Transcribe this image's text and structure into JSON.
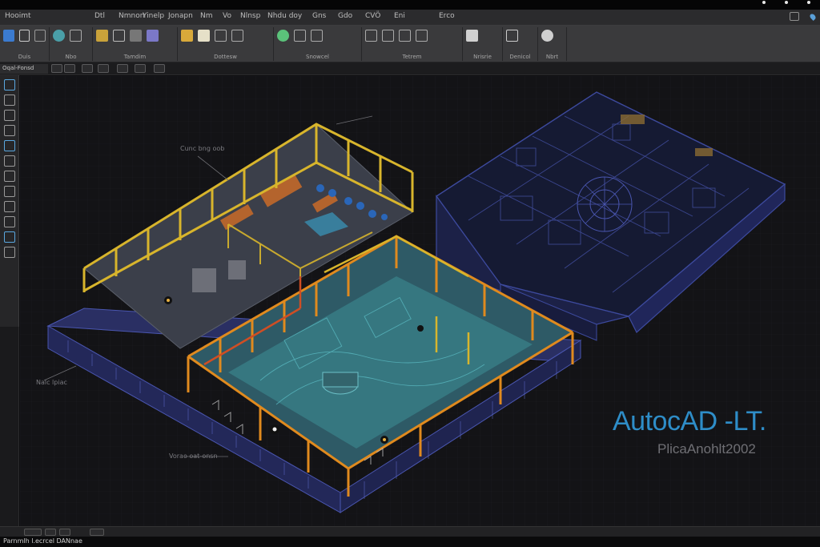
{
  "menu": [
    "Hooimt",
    "Dtl",
    "Nmnon",
    "Yinelp",
    "Jonapn",
    "Nm",
    "Vo",
    "Nlnsp",
    "Nhdu doy",
    "Gns",
    "Gdo",
    "CVÖ",
    "Eni",
    "Erco"
  ],
  "ribbon_panels": [
    "Duis",
    "Nbo",
    "Tamdim",
    "Dottesw",
    "Snowcel",
    "Tetrem",
    "Nrisrie",
    "Denicol",
    "Nbrt"
  ],
  "file_tab_label": "Oqal-Fonsd",
  "annotations": {
    "room_label": "Cunc bng oob",
    "side_note": "Nalc lpiac",
    "floor_note": "Vorao oat-onsn"
  },
  "brand": {
    "title": "AutocAD -LT.",
    "subtitle": "PlicaAnohlt2002"
  },
  "status_text": "Parnmlh l.ecrcel DANnae",
  "colors": {
    "accent_blue": "#2e8dc8",
    "frame_yellow": "#d8b52c",
    "frame_orange": "#e08a1e",
    "model_navy": "#3d4a9e",
    "water_teal": "#3e8f96"
  }
}
